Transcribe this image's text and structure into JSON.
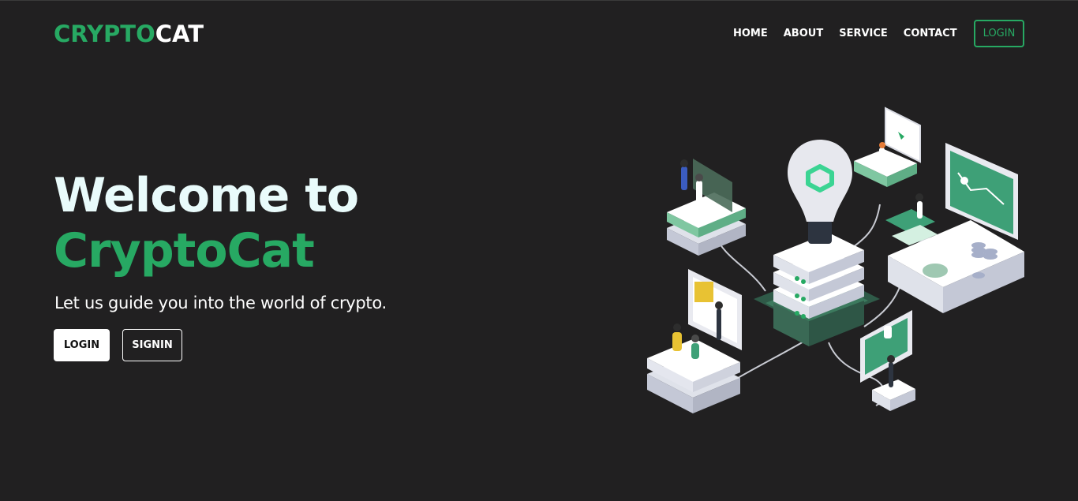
{
  "navbar": {
    "brand_part1": "CRYPTO",
    "brand_part2": "CAT",
    "links": [
      "HOME",
      "ABOUT",
      "SERVICE",
      "CONTACT"
    ],
    "login_label": "LOGIN"
  },
  "hero": {
    "title_line1": "Welcome to",
    "title_line2": "CryptoCat",
    "subtitle": "Let us guide you into the world of crypto.",
    "login_label": "LOGIN",
    "signin_label": "SIGNIN"
  },
  "illustration": {
    "icon": "isometric-crypto-network-illustration"
  },
  "colors": {
    "background": "#212021",
    "accent": "#27a963",
    "title_light": "#e9fbfb",
    "text": "#ffffff"
  }
}
